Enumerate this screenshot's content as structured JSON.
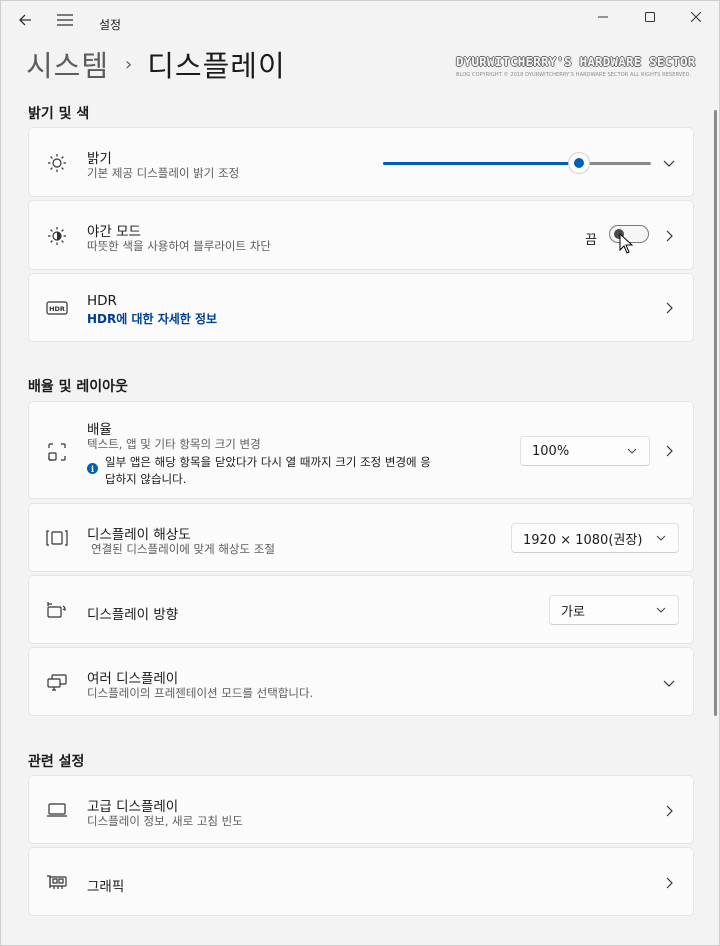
{
  "window": {
    "app_title": "설정"
  },
  "breadcrumb": {
    "parent": "시스템",
    "separator": "›",
    "current": "디스플레이"
  },
  "watermark": {
    "title": "DYURWITCHERRY'S HARDWARE SECTOR",
    "subtitle": "BLOG COPYRIGHT © 2018 DYURWITCHERRY'S HARDWARE SECTOR ALL RIGHTS RESERVED."
  },
  "sections": {
    "brightness_color": "밝기 및 색",
    "scale_layout": "배율 및 레이아웃",
    "related": "관련 설정"
  },
  "brightness": {
    "title": "밝기",
    "subtitle": "기본 제공 디스플레이 밝기 조정",
    "level": 0.73
  },
  "night_mode": {
    "title": "야간 모드",
    "subtitle": "따뜻한 색을 사용하여 블루라이트 차단",
    "state_label": "끔",
    "on": false
  },
  "hdr": {
    "icon_text": "HDR",
    "title": "HDR",
    "link": "HDR에 대한 자세한 정보"
  },
  "scale": {
    "title": "배율",
    "subtitle": "텍스트, 앱 및 기타 항목의 크기 변경",
    "info_line1": "일부 앱은 해당 항목을 닫았다가 다시 열 때까지 크기 조정 변경에 응",
    "info_line2": "답하지 않습니다.",
    "value": "100%"
  },
  "resolution": {
    "title": "디스플레이 해상도",
    "subtitle": "연결된 디스플레이에 맞게 해상도 조절",
    "value": "1920 × 1080(권장)"
  },
  "orientation": {
    "title": "디스플레이 방향",
    "value": "가로"
  },
  "multiple": {
    "title": "여러 디스플레이",
    "subtitle": "디스플레이의 프레젠테이션 모드를 선택합니다."
  },
  "advanced": {
    "title": "고급 디스플레이",
    "subtitle": "디스플레이 정보, 새로 고침 빈도"
  },
  "graphics": {
    "title": "그래픽"
  },
  "colors": {
    "accent": "#005fb8",
    "link": "#003e92"
  }
}
